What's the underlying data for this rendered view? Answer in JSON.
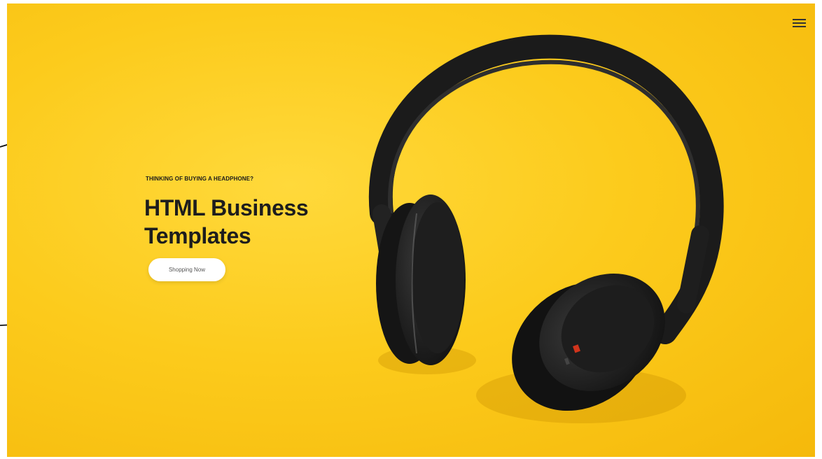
{
  "hero": {
    "eyebrow": "THINKING OF BUYING A HEADPHONE?",
    "title_line1": "HTML Business",
    "title_line2": "Templates",
    "cta_label": "Shopping Now"
  },
  "icons": {
    "menu": "hamburger-menu-icon"
  },
  "colors": {
    "background": "#fccb1c",
    "title": "#1d1d1d",
    "button": "#ffffff",
    "headphones": "#1c1c1c"
  }
}
